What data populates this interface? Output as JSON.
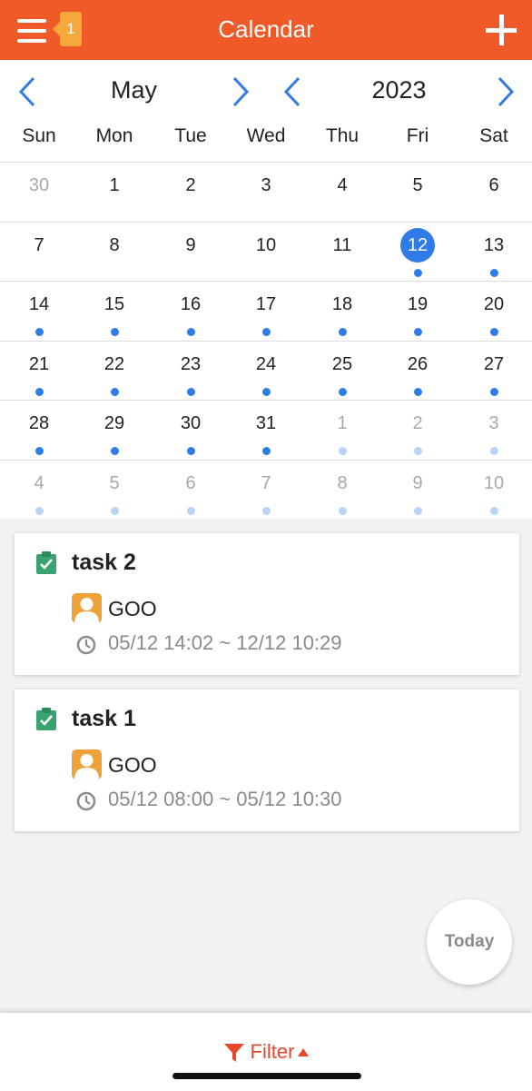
{
  "header": {
    "title": "Calendar",
    "badge_count": "1",
    "menu_icon": "hamburger-menu-icon",
    "add_icon": "plus-icon"
  },
  "calendar": {
    "month": "May",
    "year": "2023",
    "weekdays": [
      "Sun",
      "Mon",
      "Tue",
      "Wed",
      "Thu",
      "Fri",
      "Sat"
    ],
    "accent_color": "#2f7be8",
    "weeks": [
      [
        {
          "d": "30",
          "o": true,
          "t": false
        },
        {
          "d": "1",
          "o": false,
          "t": false
        },
        {
          "d": "2",
          "o": false,
          "t": false
        },
        {
          "d": "3",
          "o": false,
          "t": false
        },
        {
          "d": "4",
          "o": false,
          "t": false
        },
        {
          "d": "5",
          "o": false,
          "t": false
        },
        {
          "d": "6",
          "o": false,
          "t": false
        }
      ],
      [
        {
          "d": "7",
          "o": false,
          "t": false
        },
        {
          "d": "8",
          "o": false,
          "t": false
        },
        {
          "d": "9",
          "o": false,
          "t": false
        },
        {
          "d": "10",
          "o": false,
          "t": false
        },
        {
          "d": "11",
          "o": false,
          "t": false
        },
        {
          "d": "12",
          "o": false,
          "t": true,
          "s": true
        },
        {
          "d": "13",
          "o": false,
          "t": true
        }
      ],
      [
        {
          "d": "14",
          "o": false,
          "t": true
        },
        {
          "d": "15",
          "o": false,
          "t": true
        },
        {
          "d": "16",
          "o": false,
          "t": true
        },
        {
          "d": "17",
          "o": false,
          "t": true
        },
        {
          "d": "18",
          "o": false,
          "t": true
        },
        {
          "d": "19",
          "o": false,
          "t": true
        },
        {
          "d": "20",
          "o": false,
          "t": true
        }
      ],
      [
        {
          "d": "21",
          "o": false,
          "t": true
        },
        {
          "d": "22",
          "o": false,
          "t": true
        },
        {
          "d": "23",
          "o": false,
          "t": true
        },
        {
          "d": "24",
          "o": false,
          "t": true
        },
        {
          "d": "25",
          "o": false,
          "t": true
        },
        {
          "d": "26",
          "o": false,
          "t": true
        },
        {
          "d": "27",
          "o": false,
          "t": true
        }
      ],
      [
        {
          "d": "28",
          "o": false,
          "t": true
        },
        {
          "d": "29",
          "o": false,
          "t": true
        },
        {
          "d": "30",
          "o": false,
          "t": true
        },
        {
          "d": "31",
          "o": false,
          "t": true
        },
        {
          "d": "1",
          "o": true,
          "t": true
        },
        {
          "d": "2",
          "o": true,
          "t": true
        },
        {
          "d": "3",
          "o": true,
          "t": true
        }
      ],
      [
        {
          "d": "4",
          "o": true,
          "t": true
        },
        {
          "d": "5",
          "o": true,
          "t": true
        },
        {
          "d": "6",
          "o": true,
          "t": true
        },
        {
          "d": "7",
          "o": true,
          "t": true
        },
        {
          "d": "8",
          "o": true,
          "t": true
        },
        {
          "d": "9",
          "o": true,
          "t": true
        },
        {
          "d": "10",
          "o": true,
          "t": true
        }
      ]
    ]
  },
  "tasks": [
    {
      "title": "task 2",
      "assignee": "GOO",
      "time": "05/12 14:02 ~ 12/12 10:29"
    },
    {
      "title": "task 1",
      "assignee": "GOO",
      "time": "05/12 08:00 ~ 05/12 10:30"
    }
  ],
  "today_button": "Today",
  "footer": {
    "filter_label": "Filter",
    "filter_color": "#e8472c"
  },
  "colors": {
    "header_bg": "#f05a28",
    "badge_bg": "#f7a83a"
  }
}
